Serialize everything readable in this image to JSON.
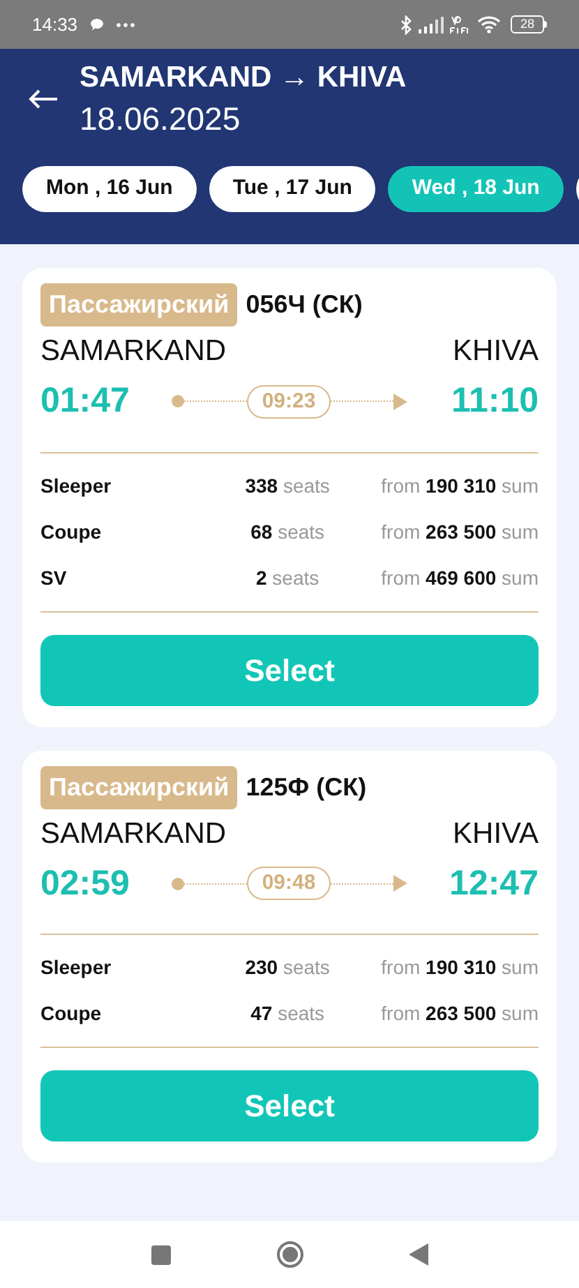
{
  "status_bar": {
    "time": "14:33",
    "battery": "28"
  },
  "header": {
    "title": "SAMARKAND → KHIVA",
    "date": "18.06.2025"
  },
  "date_tabs": [
    {
      "label": "Mon , 16 Jun",
      "selected": false
    },
    {
      "label": "Tue , 17 Jun",
      "selected": false
    },
    {
      "label": "Wed , 18 Jun",
      "selected": true
    }
  ],
  "trains": [
    {
      "type": "Пассажирский",
      "number": "056Ч (СК)",
      "from": "SAMARKAND",
      "to": "KHIVA",
      "departure": "01:47",
      "duration": "09:23",
      "arrival": "11:10",
      "classes": [
        {
          "name": "Sleeper",
          "seats": "**338** seats",
          "price": "from **190 310** sum"
        },
        {
          "name": "Coupe",
          "seats": "**68** seats",
          "price": "from **263 500** sum"
        },
        {
          "name": "SV",
          "seats": "**2** seats",
          "price": "from **469 600** sum"
        }
      ],
      "button": "Select"
    },
    {
      "type": "Пассажирский",
      "number": "125Ф (СК)",
      "from": "SAMARKAND",
      "to": "KHIVA",
      "departure": "02:59",
      "duration": "09:48",
      "arrival": "12:47",
      "classes": [
        {
          "name": "Sleeper",
          "seats": "**230** seats",
          "price": "from **190 310** sum"
        },
        {
          "name": "Coupe",
          "seats": "**47** seats",
          "price": "from **263 500** sum"
        }
      ],
      "button": "Select"
    }
  ]
}
